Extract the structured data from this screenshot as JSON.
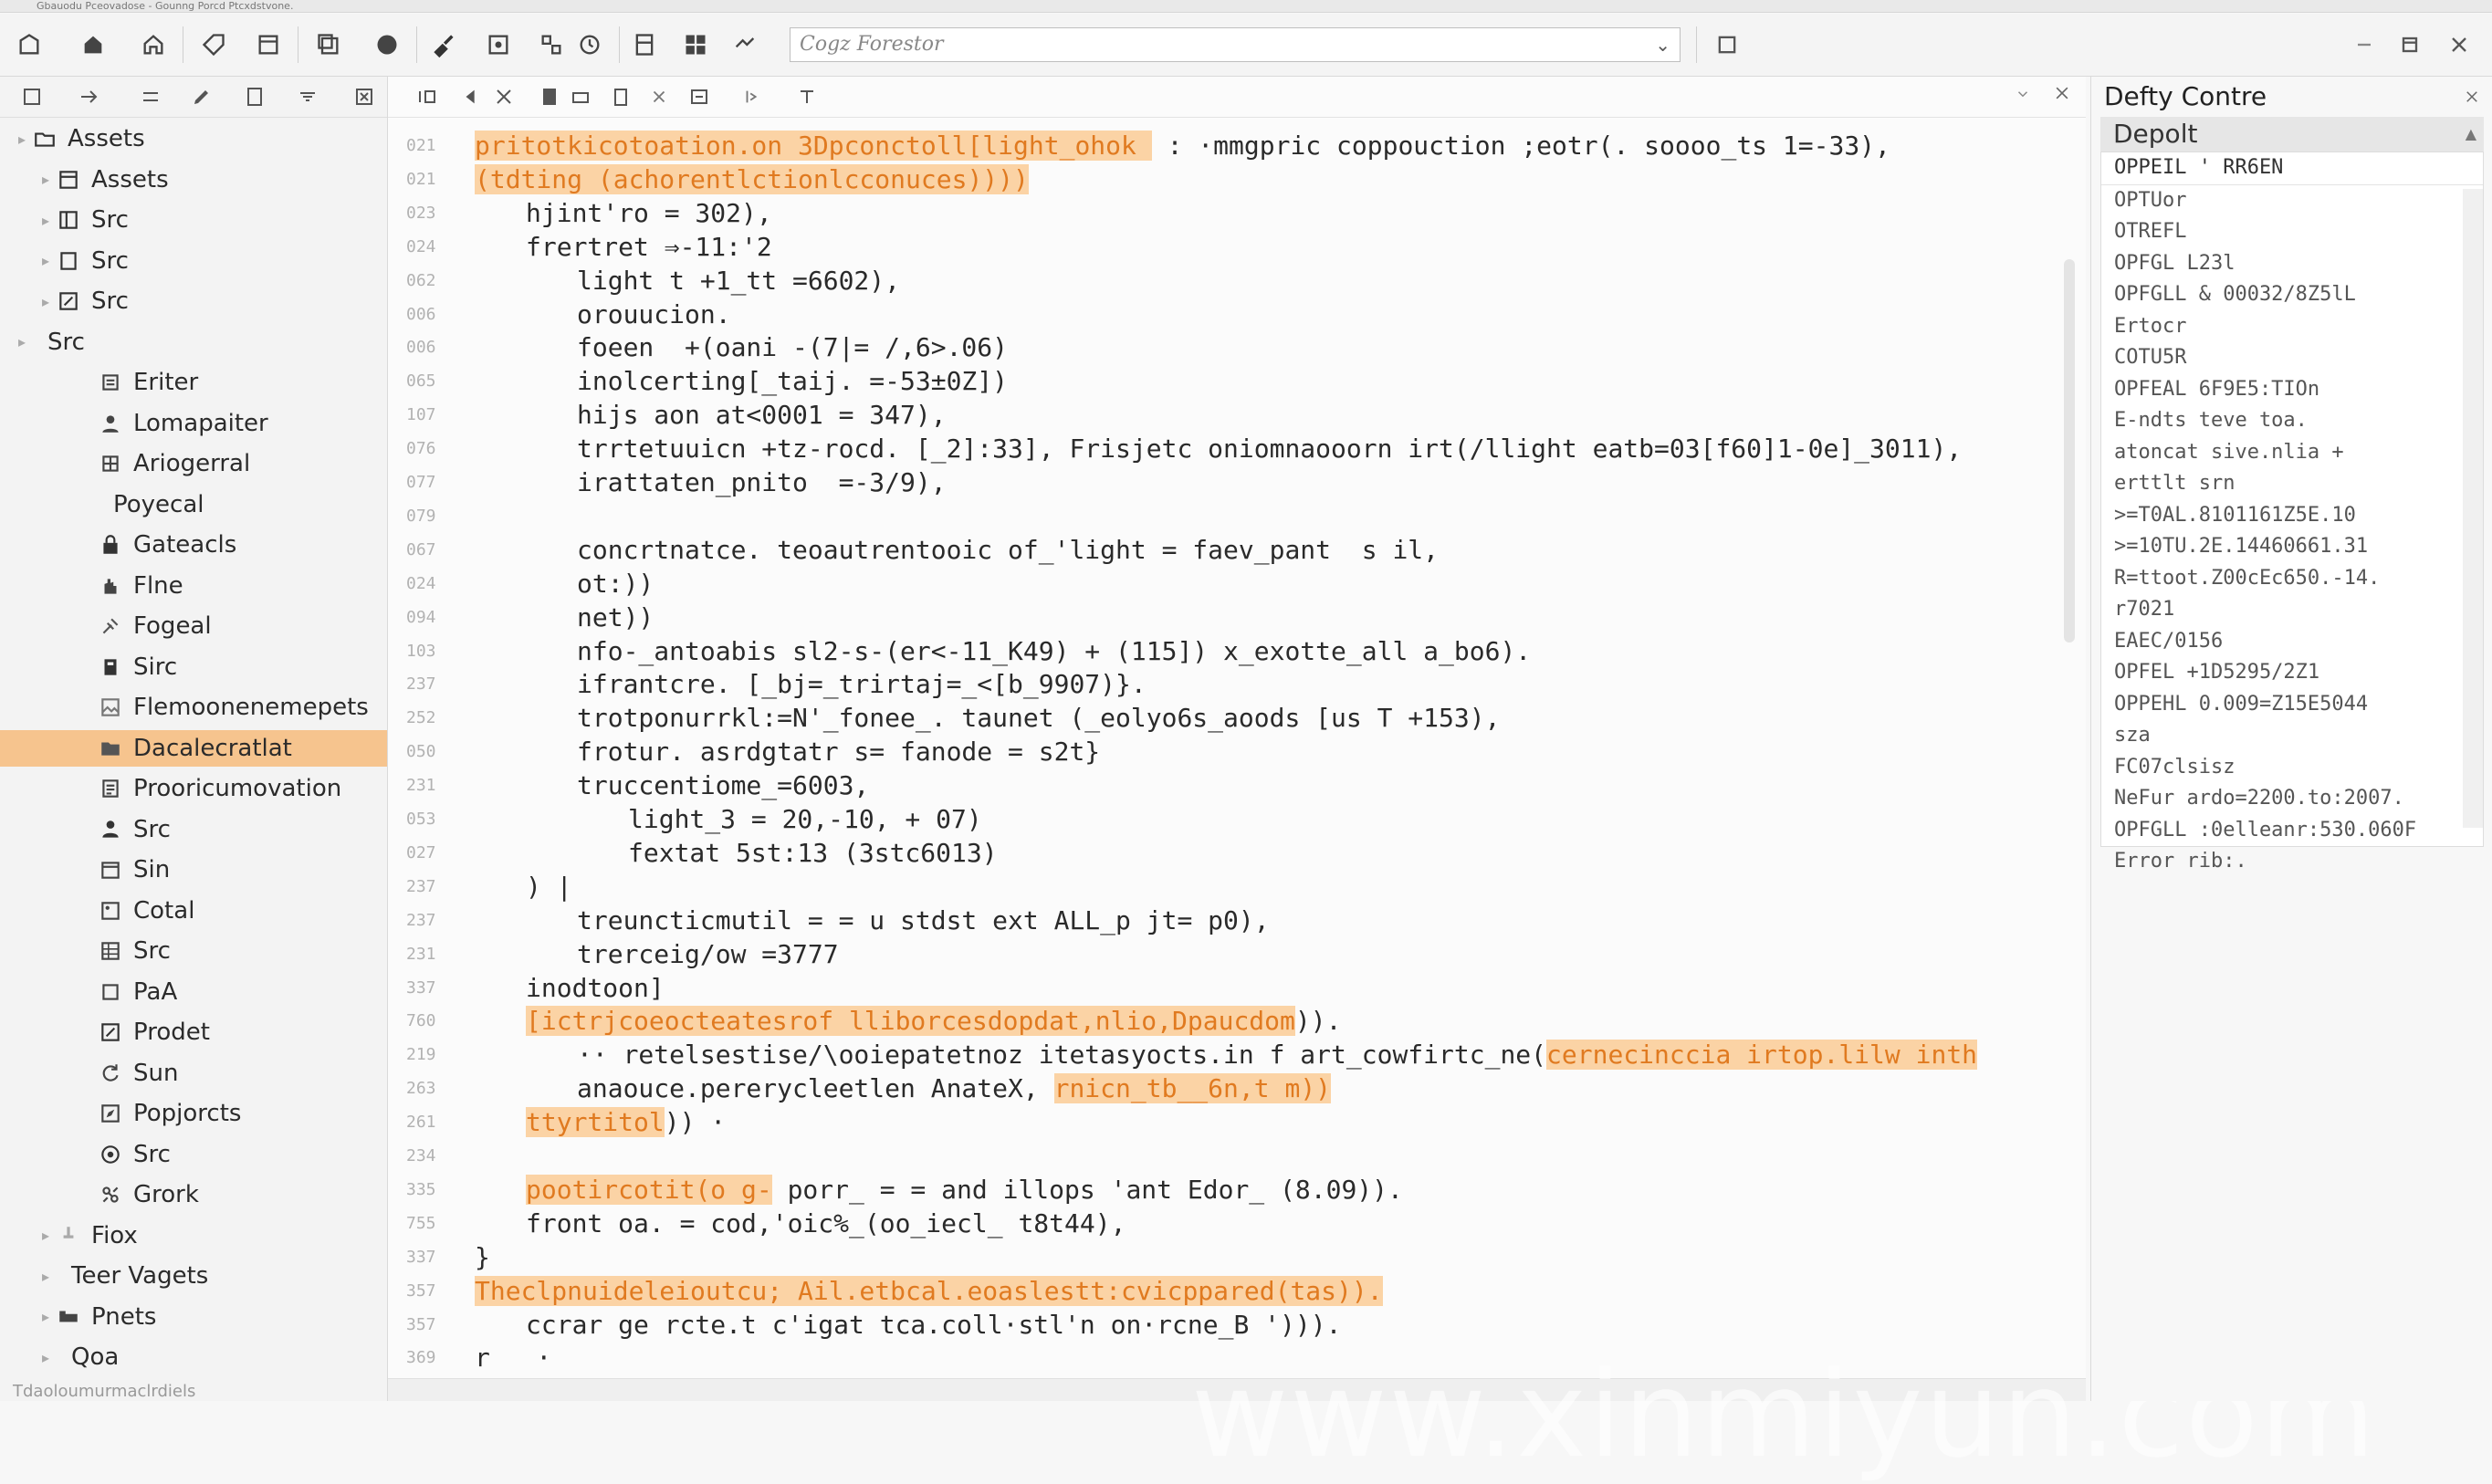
{
  "window": {
    "title": "Gbauodu Pceovadose - Gounng Porcd Ptcxdstvone."
  },
  "toolbar": {
    "combo_value": "Cogz Forestor",
    "combo_chevron": "⌄"
  },
  "tree": {
    "items": [
      {
        "label": "Assets",
        "level": 0,
        "icon": "folder-icon",
        "selected": false
      },
      {
        "label": "Assets",
        "level": 1,
        "icon": "window-icon",
        "selected": false
      },
      {
        "label": "Src",
        "level": 1,
        "icon": "panel-icon",
        "selected": false
      },
      {
        "label": "Src",
        "level": 1,
        "icon": "page-icon",
        "selected": false
      },
      {
        "label": "Src",
        "level": 1,
        "icon": "edit-icon",
        "selected": false
      },
      {
        "label": "Src",
        "level": 0,
        "icon": "",
        "selected": false
      },
      {
        "label": "Eriter",
        "level": 2,
        "icon": "gear-icon",
        "selected": false
      },
      {
        "label": "Lomapaiter",
        "level": 2,
        "icon": "user-icon",
        "selected": false
      },
      {
        "label": "Ariogerral",
        "level": 2,
        "icon": "grid-icon",
        "selected": false
      },
      {
        "label": "Poyecal",
        "level": 2,
        "icon": "",
        "selected": false
      },
      {
        "label": "Gateacls",
        "level": 2,
        "icon": "lock-icon",
        "selected": false
      },
      {
        "label": "Flne",
        "level": 2,
        "icon": "hand-icon",
        "selected": false
      },
      {
        "label": "Fogeal",
        "level": 2,
        "icon": "tools-icon",
        "selected": false
      },
      {
        "label": "Sirc",
        "level": 2,
        "icon": "book-icon",
        "selected": false
      },
      {
        "label": "Flemoonenemepets",
        "level": 2,
        "icon": "image-icon",
        "selected": false
      },
      {
        "label": "Dacalecratlat",
        "level": 2,
        "icon": "folder-open-icon",
        "selected": true
      },
      {
        "label": "Prooricumovation",
        "level": 2,
        "icon": "document-icon",
        "selected": false
      },
      {
        "label": "Src",
        "level": 2,
        "icon": "person-icon",
        "selected": false
      },
      {
        "label": "Sin",
        "level": 2,
        "icon": "calendar-icon",
        "selected": false
      },
      {
        "label": "Cotal",
        "level": 2,
        "icon": "picture-icon",
        "selected": false
      },
      {
        "label": "Src",
        "level": 2,
        "icon": "table-icon",
        "selected": false
      },
      {
        "label": "PaA",
        "level": 2,
        "icon": "square-icon",
        "selected": false
      },
      {
        "label": "Prodet",
        "level": 2,
        "icon": "edit-icon",
        "selected": false
      },
      {
        "label": "Sun",
        "level": 2,
        "icon": "refresh-icon",
        "selected": false
      },
      {
        "label": "Popjorcts",
        "level": 2,
        "icon": "edit-box-icon",
        "selected": false
      },
      {
        "label": "Src",
        "level": 2,
        "icon": "circle-check-icon",
        "selected": false
      },
      {
        "label": "Grork",
        "level": 2,
        "icon": "link-icon",
        "selected": false
      },
      {
        "label": "Fiox",
        "level": 1,
        "icon": "pin-icon",
        "selected": false
      },
      {
        "label": "Teer Vagets",
        "level": 1,
        "icon": "",
        "selected": false
      },
      {
        "label": "Pnets",
        "level": 1,
        "icon": "bed-icon",
        "selected": false
      },
      {
        "label": "Qoa",
        "level": 1,
        "icon": "",
        "selected": false
      }
    ]
  },
  "status": {
    "text": "Tdaoloumurmaclrdiels"
  },
  "editor": {
    "lines": [
      {
        "no": "021",
        "indent": 0,
        "parts": [
          {
            "t": "pritotkicotoation.on 3Dpconctoll[light_ohok ",
            "hl": true
          },
          {
            "t": " : ·mmgpric coppouction ;eotr(. soooo_ts 1=-33),",
            "hl": false
          }
        ]
      },
      {
        "no": "021",
        "indent": 0,
        "parts": [
          {
            "t": "(tdting (achorentlctionlcconuces))))",
            "hl": true
          }
        ]
      },
      {
        "no": "023",
        "indent": 1,
        "parts": [
          {
            "t": "hjint'ro = 302),",
            "hl": false
          }
        ]
      },
      {
        "no": "024",
        "indent": 1,
        "parts": [
          {
            "t": "frertret ⇒-11:'2",
            "hl": false
          }
        ]
      },
      {
        "no": "062",
        "indent": 2,
        "parts": [
          {
            "t": "light t +1_tt =6602),",
            "hl": false
          }
        ]
      },
      {
        "no": "006",
        "indent": 2,
        "parts": [
          {
            "t": "orouucion.",
            "hl": false
          }
        ]
      },
      {
        "no": "006",
        "indent": 2,
        "parts": [
          {
            "t": "foeen  +(oani -(7|= /,6>.06)",
            "hl": false
          }
        ]
      },
      {
        "no": "065",
        "indent": 2,
        "parts": [
          {
            "t": "inolcerting[_taij. =-53±0Z])",
            "hl": false
          }
        ]
      },
      {
        "no": "107",
        "indent": 2,
        "parts": [
          {
            "t": "hijs aon at<0001 = 347),",
            "hl": false
          }
        ]
      },
      {
        "no": "076",
        "indent": 2,
        "parts": [
          {
            "t": "trrtetuuicn +tz-rocd. [_2]:33], Frisjetc oniomnaooorn irt(/llight eatb=03[f60]1-0e]_3011),",
            "hl": false
          }
        ]
      },
      {
        "no": "077",
        "indent": 2,
        "parts": [
          {
            "t": "irattaten_pnito  =-3/9),",
            "hl": false
          }
        ]
      },
      {
        "no": "079",
        "indent": 0,
        "parts": []
      },
      {
        "no": "067",
        "indent": 2,
        "parts": [
          {
            "t": "concrtnatce. teoautrentooic of_'light = faev_pant  s il,",
            "hl": false
          }
        ]
      },
      {
        "no": "024",
        "indent": 2,
        "parts": [
          {
            "t": "ot:))",
            "hl": false
          }
        ]
      },
      {
        "no": "094",
        "indent": 2,
        "parts": [
          {
            "t": "net))",
            "hl": false
          }
        ]
      },
      {
        "no": "103",
        "indent": 2,
        "parts": [
          {
            "t": "nfo-_antoabis sl2-s-(er<-11_K49) + (115]) x_exotte_all a_bo6).",
            "hl": false
          }
        ]
      },
      {
        "no": "237",
        "indent": 2,
        "parts": [
          {
            "t": "ifrantcre. [_bj=_trirtaj=_<[b_9907)}.",
            "hl": false
          }
        ]
      },
      {
        "no": "252",
        "indent": 2,
        "parts": [
          {
            "t": "trotponurrkl:=N'_fonee_. taunet (_eolyo6s_aoods [us T +153),",
            "hl": false
          }
        ]
      },
      {
        "no": "050",
        "indent": 2,
        "parts": [
          {
            "t": "frotur. asrdgtatr s= fanode = s2t}",
            "hl": false
          }
        ]
      },
      {
        "no": "231",
        "indent": 2,
        "parts": [
          {
            "t": "truccentiome_=6003,",
            "hl": false
          }
        ]
      },
      {
        "no": "053",
        "indent": 3,
        "parts": [
          {
            "t": "light_3 = 20,-10, + 07)",
            "hl": false
          }
        ]
      },
      {
        "no": "027",
        "indent": 3,
        "parts": [
          {
            "t": "fextat 5st:13 (3stc6013)",
            "hl": false
          }
        ]
      },
      {
        "no": "237",
        "indent": 1,
        "parts": [
          {
            "t": ") |",
            "hl": false
          }
        ]
      },
      {
        "no": "237",
        "indent": 2,
        "parts": [
          {
            "t": "treuncticmutil = = u stdst ext ALL_p jt= p0),",
            "hl": false
          }
        ]
      },
      {
        "no": "231",
        "indent": 2,
        "parts": [
          {
            "t": "trerceig/ow =3777",
            "hl": false
          }
        ]
      },
      {
        "no": "337",
        "indent": 1,
        "parts": [
          {
            "t": "inodtoon]",
            "hl": false
          }
        ]
      },
      {
        "no": "760",
        "indent": 1,
        "parts": [
          {
            "t": "[ictrjcoeocteatesrof lliborcesdopdat,nlio,Dpaucdom",
            "hl": true
          },
          {
            "t": ")).",
            "hl": false
          }
        ]
      },
      {
        "no": "219",
        "indent": 2,
        "parts": [
          {
            "t": "·· retelsestise/\\ooiepatetnoz itetasyocts.in f art_cowfirtc_ne(",
            "hl": false
          },
          {
            "t": "cernecinccia irtop.lilw inth",
            "hl": true
          }
        ]
      },
      {
        "no": "263",
        "indent": 2,
        "parts": [
          {
            "t": "anaouce.pererycleetlen AnateX, ",
            "hl": false
          },
          {
            "t": "rnicn_tb__6n,t m))",
            "hl": true
          }
        ]
      },
      {
        "no": "261",
        "indent": 1,
        "parts": [
          {
            "t": "ttyrtitol",
            "hl": true
          },
          {
            "t": ")) ·",
            "hl": false
          }
        ]
      },
      {
        "no": "234",
        "indent": 0,
        "parts": []
      },
      {
        "no": "335",
        "indent": 1,
        "parts": [
          {
            "t": "pootircotit(o g-",
            "hl": true
          },
          {
            "t": " porr_ = = and illops 'ant Edor_ (8.09)).",
            "hl": false
          }
        ]
      },
      {
        "no": "755",
        "indent": 1,
        "parts": [
          {
            "t": "front oa. = cod,'oic%_(oo_iecl_ t8t44),",
            "hl": false
          }
        ]
      },
      {
        "no": "337",
        "indent": 0,
        "parts": [
          {
            "t": "}",
            "hl": false
          }
        ]
      },
      {
        "no": "357",
        "indent": 0,
        "parts": [
          {
            "t": "Theclpnuideleioutcu; Ail.etbcal.eoaslestt:cvicppared(tas)).",
            "hl": true
          }
        ]
      },
      {
        "no": "357",
        "indent": 1,
        "parts": [
          {
            "t": "ccrar ge rcte.t c'igat tca.coll·stl'n on·rcne_B '))).",
            "hl": false
          }
        ]
      },
      {
        "no": "369",
        "indent": 0,
        "parts": [
          {
            "t": "r   ·",
            "hl": false
          }
        ]
      }
    ]
  },
  "right_panel": {
    "title": "Defty Contre",
    "select_value": "Depolt",
    "items": [
      "OPPEIL ' RR6EN",
      "OPTUor",
      "OTREFL",
      "OPFGL L23l",
      "OPFGLL & 00032/8Z5lL",
      "Ertocr",
      "COTU5R",
      "OPFEAL 6F9E5:TIOn",
      "E-ndts teve toa.",
      "atoncat sive.nlia +",
      "erttlt srn",
      ">=T0AL.8101161Z5E.10",
      ">=10TU.2E.14460661.31",
      "R=ttoot.Z00cEc650.-14.",
      "r7021",
      "EAEC/0156",
      "OPFEL  +1D5295/2Z1",
      "OPPEHL 0.009=Z15E5044",
      "sza",
      "FC07clsisz",
      "NeFur ardo=2200.to:2007.",
      "OPFGLL :0elleanr:530.060F",
      "Error rib:."
    ]
  },
  "watermark": "www.xinmiyun.com"
}
